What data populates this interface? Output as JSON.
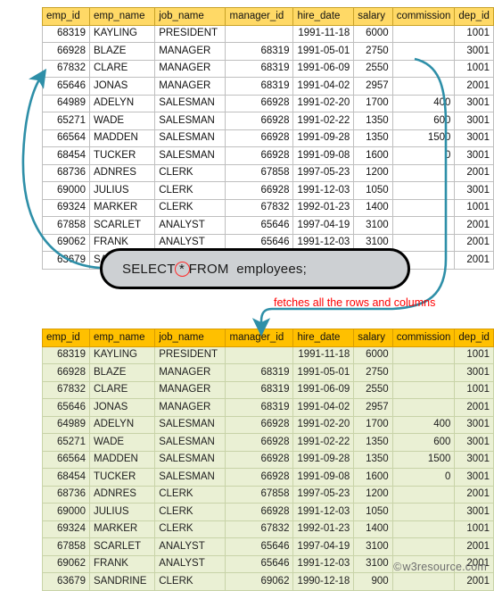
{
  "columns": [
    {
      "key": "emp_id",
      "label": "emp_id",
      "align": "num",
      "cls": "c-emp-id"
    },
    {
      "key": "emp_name",
      "label": "emp_name",
      "align": "txt",
      "cls": "c-emp-name"
    },
    {
      "key": "job_name",
      "label": "job_name",
      "align": "txt",
      "cls": "c-job-name"
    },
    {
      "key": "manager_id",
      "label": "manager_id",
      "align": "num",
      "cls": "c-manager-id"
    },
    {
      "key": "hire_date",
      "label": "hire_date",
      "align": "num",
      "cls": "c-hire-date"
    },
    {
      "key": "salary",
      "label": "salary",
      "align": "num",
      "cls": "c-salary"
    },
    {
      "key": "commission",
      "label": "commission",
      "align": "num",
      "cls": "c-commission"
    },
    {
      "key": "dep_id",
      "label": "dep_id",
      "align": "num",
      "cls": "c-dep-id"
    }
  ],
  "rows": [
    [
      "68319",
      "KAYLING",
      "PRESIDENT",
      "",
      "1991-11-18",
      "6000",
      "",
      "1001"
    ],
    [
      "66928",
      "BLAZE",
      "MANAGER",
      "68319",
      "1991-05-01",
      "2750",
      "",
      "3001"
    ],
    [
      "67832",
      "CLARE",
      "MANAGER",
      "68319",
      "1991-06-09",
      "2550",
      "",
      "1001"
    ],
    [
      "65646",
      "JONAS",
      "MANAGER",
      "68319",
      "1991-04-02",
      "2957",
      "",
      "2001"
    ],
    [
      "64989",
      "ADELYN",
      "SALESMAN",
      "66928",
      "1991-02-20",
      "1700",
      "400",
      "3001"
    ],
    [
      "65271",
      "WADE",
      "SALESMAN",
      "66928",
      "1991-02-22",
      "1350",
      "600",
      "3001"
    ],
    [
      "66564",
      "MADDEN",
      "SALESMAN",
      "66928",
      "1991-09-28",
      "1350",
      "1500",
      "3001"
    ],
    [
      "68454",
      "TUCKER",
      "SALESMAN",
      "66928",
      "1991-09-08",
      "1600",
      "0",
      "3001"
    ],
    [
      "68736",
      "ADNRES",
      "CLERK",
      "67858",
      "1997-05-23",
      "1200",
      "",
      "2001"
    ],
    [
      "69000",
      "JULIUS",
      "CLERK",
      "66928",
      "1991-12-03",
      "1050",
      "",
      "3001"
    ],
    [
      "69324",
      "MARKER",
      "CLERK",
      "67832",
      "1992-01-23",
      "1400",
      "",
      "1001"
    ],
    [
      "67858",
      "SCARLET",
      "ANALYST",
      "65646",
      "1997-04-19",
      "3100",
      "",
      "2001"
    ],
    [
      "69062",
      "FRANK",
      "ANALYST",
      "65646",
      "1991-12-03",
      "3100",
      "",
      "2001"
    ],
    [
      "63679",
      "SANDRINE",
      "CLERK",
      "69062",
      "1990-12-18",
      "900",
      "",
      "2001"
    ]
  ],
  "sql": {
    "before_star": "SELECT",
    "star": "*",
    "after_star": "FROM  employees;"
  },
  "annotation": {
    "text": "fetches  all the rows and columns"
  },
  "watermark": {
    "symbol": "©",
    "text": "w3resource.com"
  },
  "colors": {
    "header_top": "#ffd966",
    "header_bottom": "#ffc000",
    "row_bottom": "#eaf0d4",
    "arrow": "#2e8fa8",
    "annotation": "#ff0000",
    "pill_fill": "#cdd0d3",
    "pill_border": "#000000",
    "star_ring": "#ff2a2a"
  }
}
